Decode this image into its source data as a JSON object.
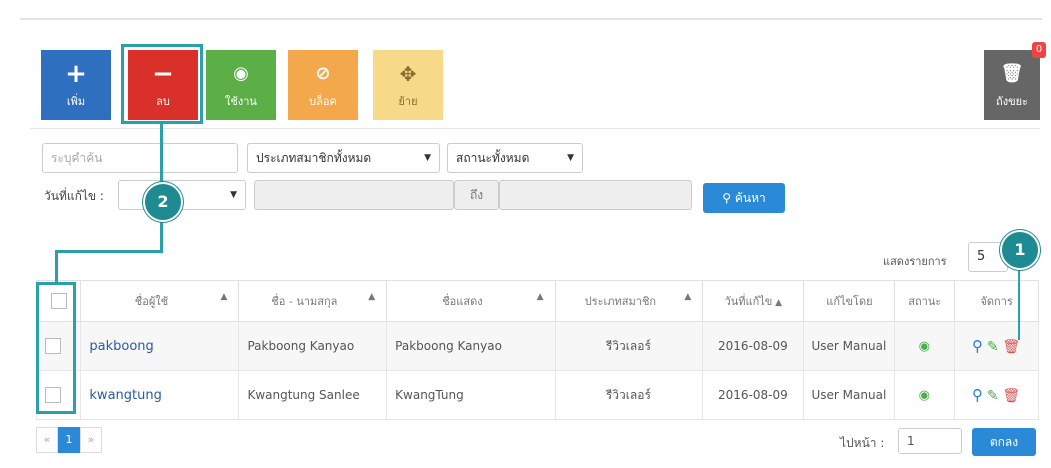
{
  "toolbar": {
    "add_label": "เพิ่ม",
    "delete_label": "ลบ",
    "use_label": "ใช้งาน",
    "block_label": "บล็อค",
    "move_label": "ย้าย",
    "trash_label": "ถังขยะ",
    "trash_count": "0"
  },
  "filters": {
    "keyword_placeholder": "ระบุคำค้น",
    "member_type": "ประเภทสมาชิกทั้งหมด",
    "status": "สถานะทั้งหมด",
    "edit_date_label": "วันที่แก้ไข :",
    "range_to": "ถึง",
    "search_label": "ค้นหา"
  },
  "list": {
    "per_page_label": "แสดงรายการ",
    "per_page_value": "5",
    "columns": [
      "ชื่อผู้ใช้",
      "ชื่อ - นามสกุล",
      "ชื่อแสดง",
      "ประเภทสมาชิก",
      "วันที่แก้ไข",
      "แก้ไขโดย",
      "สถานะ",
      "จัดการ"
    ],
    "rows": [
      {
        "username": "pakboong",
        "fullname": "Pakboong Kanyao",
        "display": "Pakboong Kanyao",
        "type": "รีวิวเลอร์",
        "date": "2016-08-09",
        "by": "User Manual"
      },
      {
        "username": "kwangtung",
        "fullname": "Kwangtung Sanlee",
        "display": "KwangTung",
        "type": "รีวิวเลอร์",
        "date": "2016-08-09",
        "by": "User Manual"
      }
    ]
  },
  "pager": {
    "prev": "«",
    "current": "1",
    "next": "»",
    "goto_label": "ไปหน้า :",
    "goto_value": "1",
    "ok_label": "ตกลง"
  },
  "markers": {
    "one": "1",
    "two": "2"
  },
  "colors": {
    "add": "#2f6fc0",
    "delete": "#d9302a",
    "use": "#5cae47",
    "block": "#f3a84b",
    "move": "#f7d98a",
    "highlight": "#2aa0a8"
  }
}
